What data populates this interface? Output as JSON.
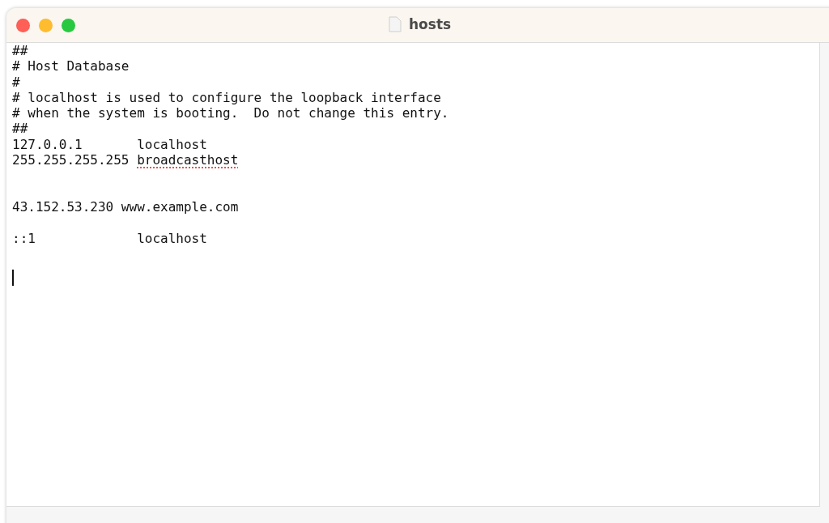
{
  "window": {
    "title": "hosts"
  },
  "document": {
    "lines": [
      {
        "kind": "text",
        "segments": [
          {
            "text": "##",
            "misspelled": false
          }
        ]
      },
      {
        "kind": "text",
        "segments": [
          {
            "text": "# Host Database",
            "misspelled": false
          }
        ]
      },
      {
        "kind": "text",
        "segments": [
          {
            "text": "#",
            "misspelled": false
          }
        ]
      },
      {
        "kind": "text",
        "segments": [
          {
            "text": "# localhost is used to configure the loopback interface",
            "misspelled": false
          }
        ]
      },
      {
        "kind": "text",
        "segments": [
          {
            "text": "# when the system is booting.  Do not change this entry.",
            "misspelled": false
          }
        ]
      },
      {
        "kind": "text",
        "segments": [
          {
            "text": "##",
            "misspelled": false
          }
        ]
      },
      {
        "kind": "text",
        "segments": [
          {
            "text": "127.0.0.1       localhost",
            "misspelled": false
          }
        ]
      },
      {
        "kind": "text",
        "segments": [
          {
            "text": "255.255.255.255 ",
            "misspelled": false
          },
          {
            "text": "broadcasthost",
            "misspelled": true
          }
        ]
      },
      {
        "kind": "blank"
      },
      {
        "kind": "blank"
      },
      {
        "kind": "text",
        "segments": [
          {
            "text": "43.152.53.230 www.example.com",
            "misspelled": false
          }
        ]
      },
      {
        "kind": "blank"
      },
      {
        "kind": "text",
        "segments": [
          {
            "text": "::1             localhost",
            "misspelled": false
          }
        ]
      },
      {
        "kind": "blank"
      },
      {
        "kind": "caret"
      }
    ]
  }
}
